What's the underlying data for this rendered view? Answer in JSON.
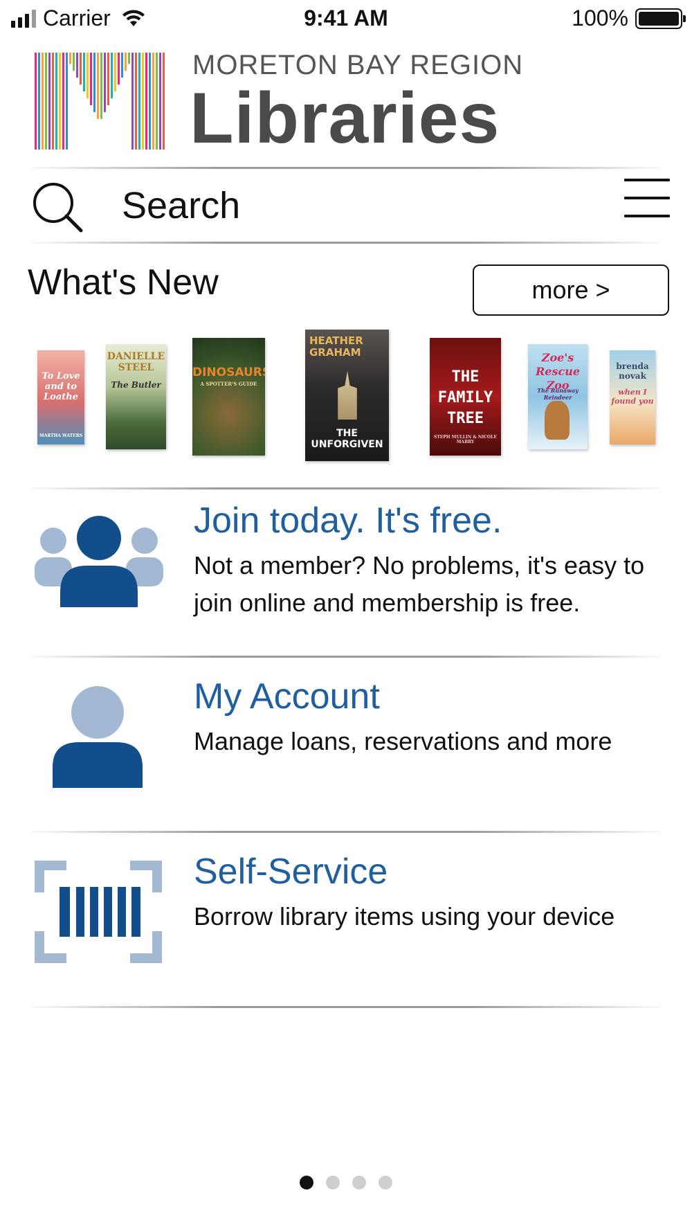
{
  "status_bar": {
    "carrier": "Carrier",
    "time": "9:41 AM",
    "battery_percent": "100%"
  },
  "header": {
    "region": "MORETON BAY REGION",
    "title": "Libraries",
    "logo_stripe_colors": [
      "#e8267a",
      "#2a8fd4",
      "#f2a33a",
      "#7cc04b",
      "#8b4fb0",
      "#f05a3c",
      "#1fb1a8",
      "#f3c623"
    ]
  },
  "search": {
    "placeholder": "Search"
  },
  "whats_new": {
    "title": "What's New",
    "more_label": "more >",
    "books": [
      {
        "title": "To Love and to Loathe",
        "author": "MARTHA WATERS"
      },
      {
        "title": "The Butler",
        "author": "DANIELLE STEEL"
      },
      {
        "title": "DINOSAURS",
        "subtitle": "A SPOTTER'S GUIDE"
      },
      {
        "title": "THE UNFORGIVEN",
        "author": "HEATHER GRAHAM"
      },
      {
        "title": "THE FAMILY TREE",
        "author": "STEPH MULLIN & NICOLE MABRY"
      },
      {
        "title": "Zoe's Rescue Zoo",
        "subtitle": "The Runaway Reindeer"
      },
      {
        "title": "when I found you",
        "author": "brenda novak"
      }
    ]
  },
  "features": [
    {
      "title": "Join today. It's free.",
      "description": "Not a member? No problems, it's easy to join online and membership is free.",
      "icon": "group-icon"
    },
    {
      "title": "My Account",
      "description": "Manage loans, reservations and more",
      "icon": "person-icon"
    },
    {
      "title": "Self-Service",
      "description": "Borrow library items using your device",
      "icon": "barcode-scan-icon"
    }
  ],
  "colors": {
    "accent_dark": "#134e8c",
    "accent_light": "#a3b9d3",
    "link_title": "#1f5fa0"
  },
  "pager": {
    "count": 4,
    "active_index": 0
  }
}
